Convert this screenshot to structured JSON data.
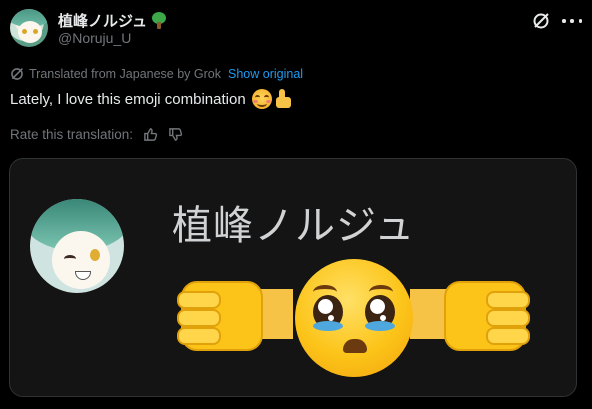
{
  "header": {
    "display_name": "植峰ノルジュ",
    "handle": "@Noruju_U"
  },
  "translation": {
    "notice": "Translated from Japanese by Grok",
    "show_original_label": "Show original"
  },
  "tweet": {
    "text": "Lately, I love this emoji combination"
  },
  "rating": {
    "label": "Rate this translation:"
  },
  "media": {
    "name_text": "植峰ノルジュ"
  },
  "icons": [
    "avatar",
    "tree-icon",
    "grok-icon",
    "more-icon",
    "thumbs-up-icon",
    "thumbs-down-icon",
    "smiling-face-emoji",
    "thumbs-up-emoji",
    "pleading-face-emoji",
    "fist-bump-emoji"
  ],
  "colors": {
    "background": "#000000",
    "text": "#e7e9ea",
    "muted": "#71767b",
    "link": "#1d9bf0"
  }
}
